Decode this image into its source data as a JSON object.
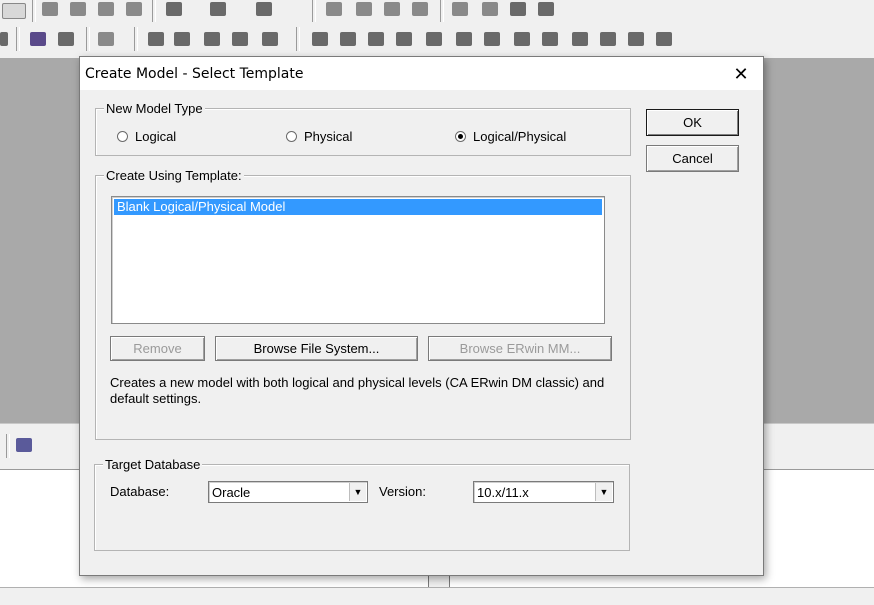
{
  "dialog": {
    "title": "Create Model - Select Template",
    "close_label": "✕"
  },
  "model_type": {
    "legend": "New Model Type",
    "options": [
      {
        "label": "Logical",
        "selected": false
      },
      {
        "label": "Physical",
        "selected": false
      },
      {
        "label": "Logical/Physical",
        "selected": true
      }
    ]
  },
  "template": {
    "legend": "Create Using Template:",
    "items": [
      "Blank Logical/Physical Model"
    ],
    "selected_index": 0,
    "remove_label": "Remove",
    "browse_fs_label": "Browse File System...",
    "browse_mm_label": "Browse ERwin MM...",
    "description": "Creates a new model with both logical and physical levels (CA ERwin DM classic) and default settings."
  },
  "target": {
    "legend": "Target Database",
    "database_label": "Database:",
    "database_value": "Oracle",
    "version_label": "Version:",
    "version_value": "10.x/11.x"
  },
  "buttons": {
    "ok_label": "OK",
    "cancel_label": "Cancel"
  },
  "colors": {
    "selection": "#3399ff",
    "dialog_bg": "#f0f0f0",
    "workspace": "#a9a9a9"
  }
}
